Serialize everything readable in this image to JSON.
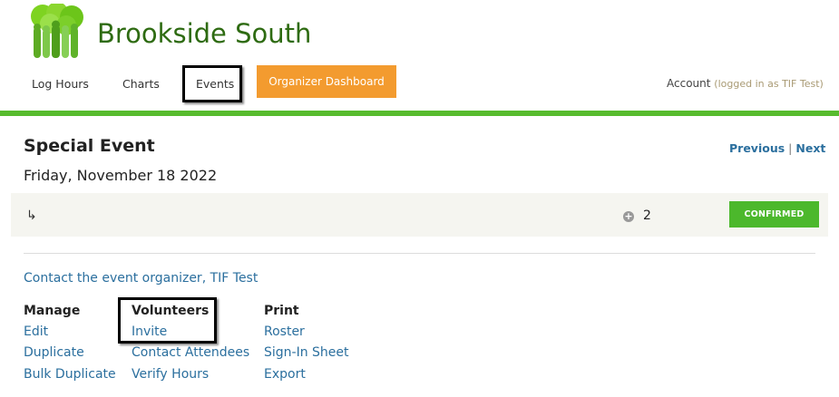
{
  "header": {
    "site_title": "Brookside South",
    "nav": {
      "log_hours": "Log Hours",
      "charts": "Charts",
      "events": "Events",
      "organizer_dashboard": "Organizer Dashboard"
    },
    "account": {
      "label": "Account",
      "logged_in": "(logged in as TIF Test)"
    }
  },
  "event": {
    "title": "Special Event",
    "date": "Friday, November 18 2022",
    "pager": {
      "previous": "Previous",
      "separator": "|",
      "next": "Next"
    },
    "shift": {
      "arrow": "↳",
      "count": "2",
      "status": "CONFIRMED"
    },
    "contact": "Contact the event organizer, TIF Test"
  },
  "sections": {
    "manage": {
      "heading": "Manage",
      "links": [
        "Edit",
        "Duplicate",
        "Bulk Duplicate"
      ]
    },
    "volunteers": {
      "heading": "Volunteers",
      "links": [
        "Invite",
        "Contact Attendees",
        "Verify Hours"
      ]
    },
    "print": {
      "heading": "Print",
      "links": [
        "Roster",
        "Sign-In Sheet",
        "Export"
      ]
    }
  },
  "colors": {
    "brand_green": "#2e6b12",
    "bar_green": "#57bb2e",
    "orange": "#f39b2f",
    "link_blue": "#2b6f9e",
    "confirmed_green": "#4cb82c"
  },
  "icons": {
    "logo": "tree-people-logo",
    "plus": "plus-circle-icon",
    "arrow": "subdirectory-arrow-icon"
  }
}
